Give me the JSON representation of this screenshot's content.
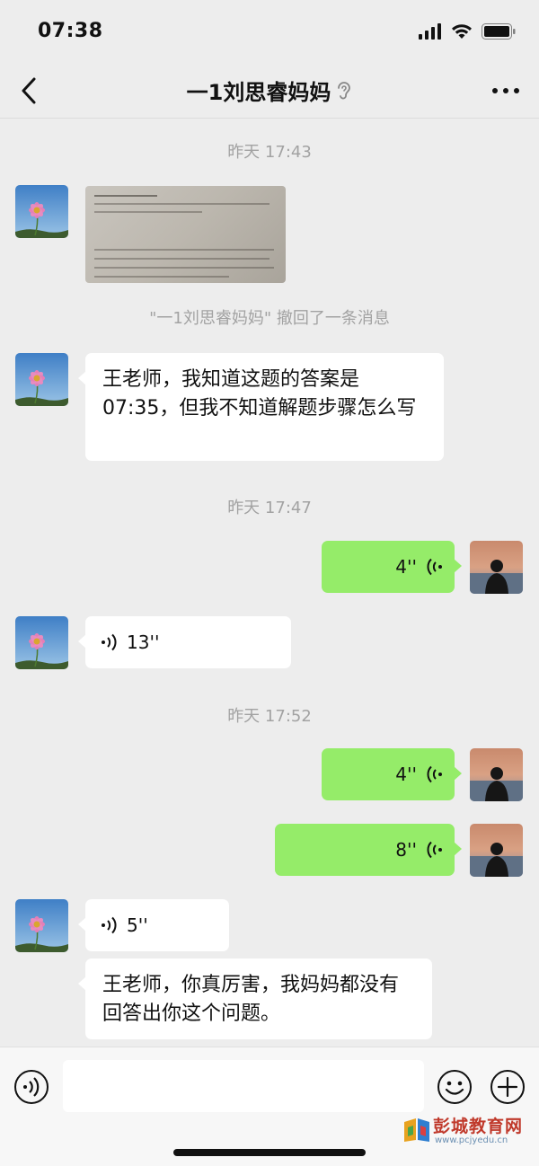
{
  "status_bar": {
    "time": "07:38"
  },
  "header": {
    "title": "一1刘思睿妈妈"
  },
  "messages": {
    "ts1": "昨天 17:43",
    "recall_notice": "\"一1刘思睿妈妈\" 撤回了一条消息",
    "text1": "王老师，我知道这题的答案是07:35，但我不知道解题步骤怎么写",
    "ts2": "昨天 17:47",
    "voice_out1": "4''",
    "voice_in1": "13''",
    "ts3": "昨天 17:52",
    "voice_out2": "4''",
    "voice_out3": "8''",
    "voice_in2": "5''",
    "text2": "王老师，你真厉害，我妈妈都没有回答出你这个问题。"
  },
  "watermark": {
    "title": "彭城教育网",
    "url": "www.pcjyedu.cn"
  },
  "colors": {
    "bubble_out": "#95ec69",
    "bubble_in": "#ffffff",
    "background": "#ededed"
  }
}
